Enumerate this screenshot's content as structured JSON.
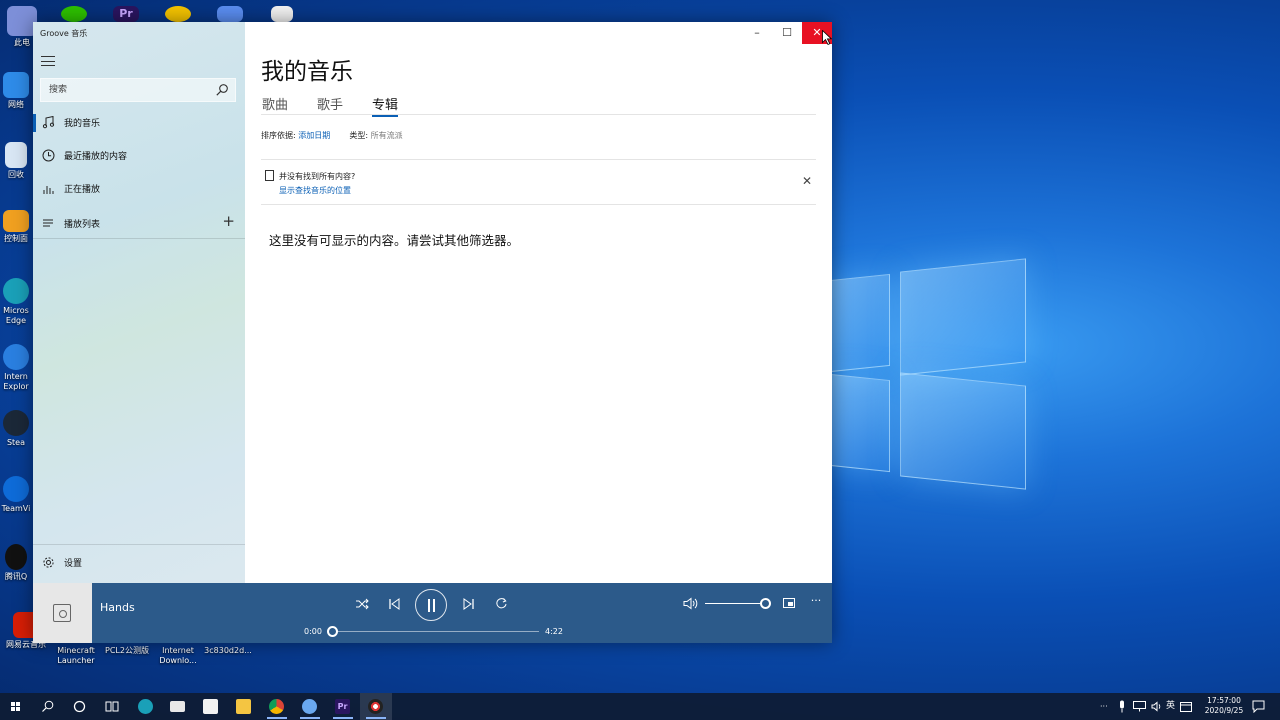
{
  "desktop": {
    "icons": [
      {
        "label": "此电",
        "color": "#7d8fd8"
      },
      {
        "label": "网络",
        "color": "#2e8be8"
      },
      {
        "label": "回收",
        "color": "#d8e6f4"
      },
      {
        "label": "控制面",
        "color": "#f0a020"
      },
      {
        "label": "Micros Edge",
        "color": "#1aa0b8"
      },
      {
        "label": "Intern Explor",
        "color": "#2a7fe0"
      },
      {
        "label": "Stea",
        "color": "#1b2838"
      },
      {
        "label": "TeamVi",
        "color": "#0e6bd8"
      },
      {
        "label": "腾讯Q",
        "color": "#111111"
      },
      {
        "label": "网易云音乐",
        "color": "#d81e06"
      }
    ],
    "top_icons": [
      {
        "name": "wechat-icon",
        "color": "#2dc100"
      },
      {
        "name": "premiere-icon",
        "color": "#2a1560"
      },
      {
        "name": "app-icon",
        "color": "#f4c300"
      },
      {
        "name": "feishu-icon",
        "color": "#5a8df0"
      },
      {
        "name": "doc-icon",
        "color": "#f2f2f2"
      }
    ],
    "bottom_labels": [
      "Minecraft Launcher",
      "PCL2公测版",
      "Internet Downlo...",
      "3c830d2d..."
    ]
  },
  "window": {
    "app_title": "Groove 音乐",
    "search_placeholder": "搜索",
    "nav": [
      {
        "label": "我的音乐",
        "icon": "music-note-icon",
        "active": true
      },
      {
        "label": "最近播放的内容",
        "icon": "clock-icon",
        "active": false
      },
      {
        "label": "正在播放",
        "icon": "bars-icon",
        "active": false
      },
      {
        "label": "播放列表",
        "icon": "playlist-icon",
        "active": false
      }
    ],
    "settings_label": "设置",
    "caption": {
      "minimize": "–",
      "maximize": "☐",
      "close": "✕"
    },
    "page_title": "我的音乐",
    "tabs": [
      {
        "label": "歌曲",
        "active": false
      },
      {
        "label": "歌手",
        "active": false
      },
      {
        "label": "专辑",
        "active": true
      }
    ],
    "sort": {
      "label": "排序依据:",
      "value": "添加日期",
      "type_label": "类型:",
      "type_value": "所有流派"
    },
    "notice": {
      "text": "并没有找到所有内容?",
      "link": "显示查找音乐的位置"
    },
    "empty_message": "这里没有可显示的内容。请尝试其他筛选器。"
  },
  "player": {
    "track": "Hands",
    "elapsed": "0:00",
    "duration": "4:22",
    "progress": 0.0,
    "volume": 1.0
  },
  "taskbar": {
    "ime": "英",
    "time": "17:57:00",
    "date": "2020/9/25",
    "tray_more": "⌃",
    "ellipsis": "···"
  },
  "colors": {
    "accent": "#0a5fb5",
    "player_bg": "#2c5a8a",
    "close_red": "#e81123"
  }
}
